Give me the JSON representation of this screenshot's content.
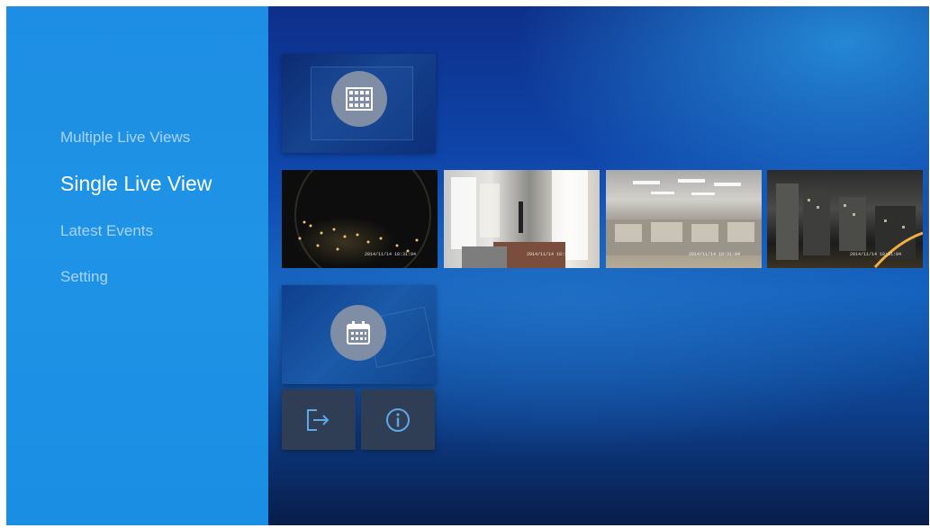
{
  "sidebar": {
    "items": [
      {
        "label": "Multiple Live Views",
        "state": "inactive"
      },
      {
        "label": "Single Live View",
        "state": "active"
      },
      {
        "label": "Latest Events",
        "state": "inactive"
      },
      {
        "label": "Setting",
        "state": "inactive"
      }
    ]
  },
  "tiles": {
    "multiple_view_icon": "grid-icon",
    "playback_icon": "calendar-icon",
    "logout_icon": "logout-icon",
    "info_icon": "info-icon"
  },
  "cameras": [
    {
      "stamp": "2014/11/14  18:31:04"
    },
    {
      "stamp": "2014/11/14  18:31:04"
    },
    {
      "stamp": "2014/11/14  18:31:04"
    },
    {
      "stamp": "2014/11/14  18:31:04"
    }
  ],
  "colors": {
    "sidebar_bg": "#1d8ee3",
    "active_text": "#ffffff",
    "inactive_text": "#a9d4f5",
    "tile_icon_circle": "#7f8ea4"
  }
}
